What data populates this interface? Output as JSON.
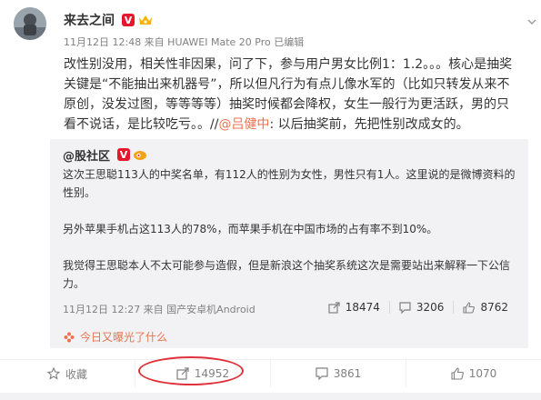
{
  "post": {
    "author": "来去之间",
    "meta": "11月12日 12:48 来自 HUAWEI Mate 20 Pro  已编辑",
    "text_plain": "改性别没用，相关性非因果，问了下，参与用户男女比例1：1.2。。。核心是抽奖关键是“不能抽出来机器号”，所以但凡行为有点儿像水军的（比如只转发从来不原创，没发过图，等等等等）抽奖时候都会降权，女生一般行为更活跃，男的只看不说话，是比较吃亏。。//",
    "mention": "@吕健中",
    "text_tail": ": 以后抽奖前，先把性别改成女的。"
  },
  "repost": {
    "author": "@股社区",
    "paragraphs": [
      "这次王思聪113人的中奖名单，有112人的性别为女性，男性只有1人。这里说的是微博资料的性别。",
      "另外苹果手机占这113人的78%，而苹果手机在中国市场的占有率不到10%。",
      "我觉得王思聪本人不太可能参与造假，但是新浪这个抽奖系统这次是需要站出来解释一下公信力。"
    ],
    "meta": "11月12日 12:27 来自 国产安卓机Android",
    "stats": {
      "reposts": "18474",
      "comments": "3206",
      "likes": "8762"
    }
  },
  "exposure_label": "今日又曝光了什么",
  "actions": {
    "favorite": "收藏",
    "repost": "14952",
    "comment": "3861",
    "like": "1070"
  },
  "colors": {
    "accent": "#eb7350",
    "verified": "#e6162d",
    "highlight": "#e0303a"
  }
}
